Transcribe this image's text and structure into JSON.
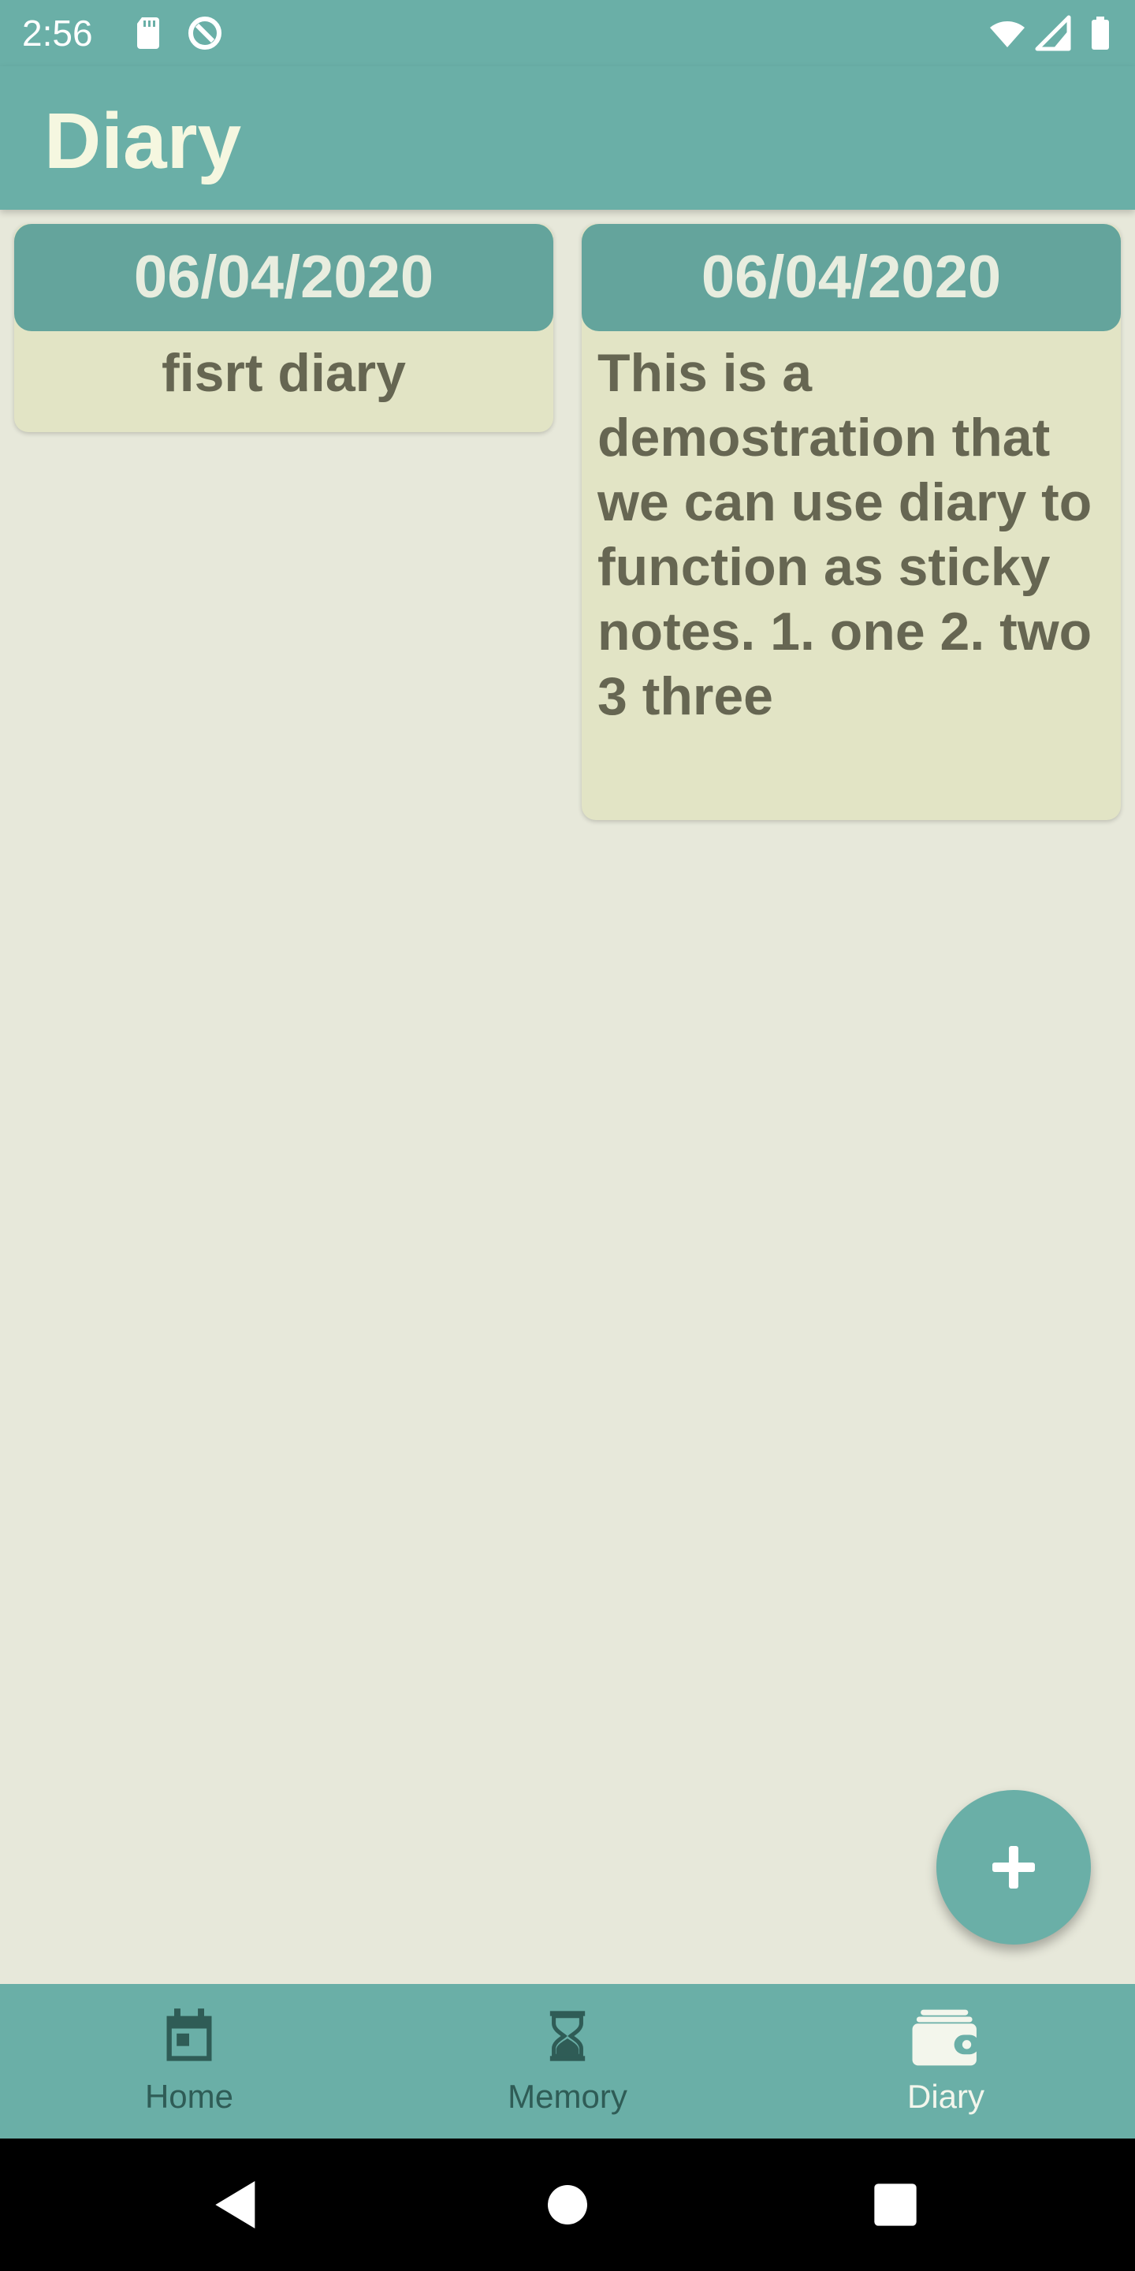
{
  "status_bar": {
    "time": "2:56",
    "icons": [
      "sd-card-icon",
      "data-saver-icon",
      "wifi-icon",
      "cellular-signal-icon",
      "battery-icon"
    ]
  },
  "app_bar": {
    "title": "Diary"
  },
  "entries": [
    {
      "date": "06/04/2020",
      "text": "fisrt diary"
    },
    {
      "date": "06/04/2020",
      "text": "This is a demostration that we can use diary to function as sticky notes.                   1. one                 2. two 3 three"
    }
  ],
  "fab": {
    "icon": "plus-icon"
  },
  "bottom_nav": {
    "items": [
      {
        "label": "Home",
        "icon": "calendar-icon",
        "active": false
      },
      {
        "label": "Memory",
        "icon": "hourglass-icon",
        "active": false
      },
      {
        "label": "Diary",
        "icon": "wallet-icon",
        "active": true
      }
    ]
  },
  "system_nav": {
    "buttons": [
      "back-icon",
      "home-circle-icon",
      "recents-icon"
    ]
  },
  "colors": {
    "primary": "#6aafa7",
    "card_header": "#64a49c",
    "card_body": "#e2e4c5",
    "background": "#e7e8da",
    "text": "#666652"
  }
}
